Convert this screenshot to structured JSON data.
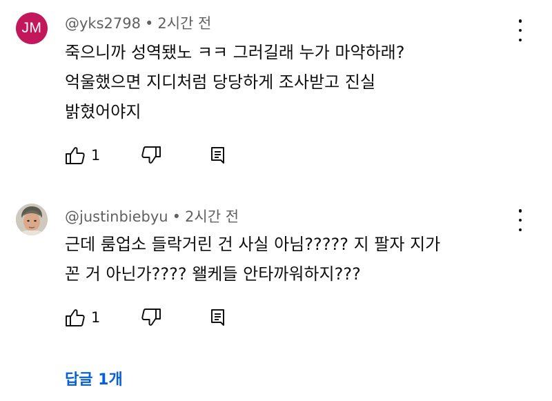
{
  "comments": [
    {
      "author": "@yks2798",
      "time": "2시간 전",
      "avatar_initials": "JM",
      "avatar_color": "#c2185b",
      "lines": [
        "죽으니까 성역됐노 ㅋㅋ 그러길래 누가 마약하래?",
        "억울했으면 지디처럼 당당하게 조사받고 진실",
        "밝혔어야지"
      ],
      "likes": "1"
    },
    {
      "author": "@justinbiebyu",
      "time": "2시간 전",
      "avatar_icon": "profile-photo",
      "lines": [
        "근데 룸업소 들락거린 건 사실 아님????? 지 팔자 지가",
        "꼰 거 아닌가???? 왤케들 안타까워하지???"
      ],
      "likes": "1"
    }
  ],
  "separator": "•",
  "replies_label": "답글 1개",
  "colors": {
    "link": "#065fd4",
    "meta": "#606060",
    "text": "#0f0f0f"
  }
}
